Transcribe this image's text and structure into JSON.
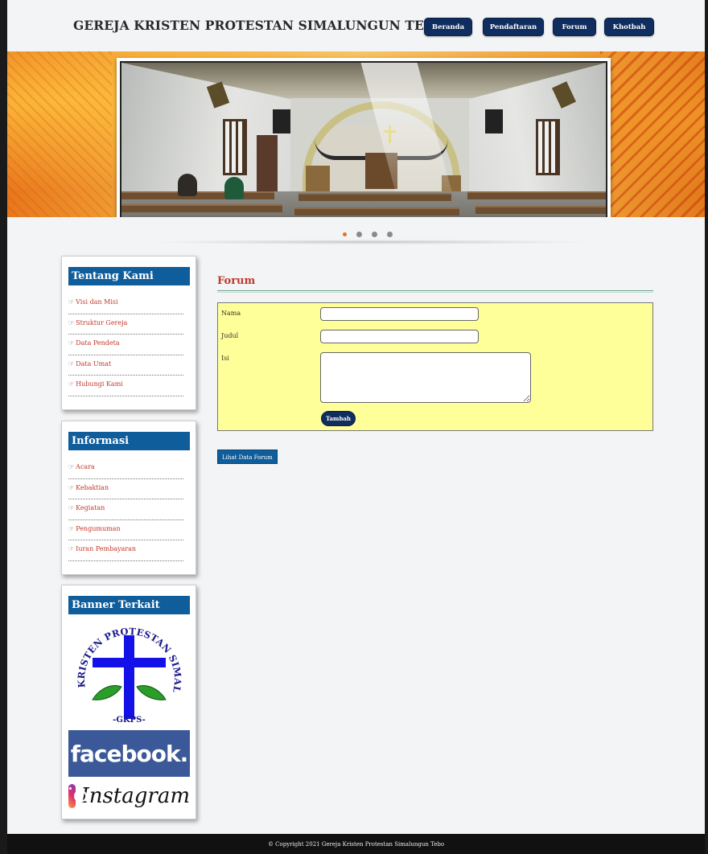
{
  "header": {
    "site_title": "GEREJA KRISTEN PROTESTAN SIMALUNGUN TEBO",
    "nav": [
      "Beranda",
      "Pendaftaran",
      "Forum",
      "Khotbah"
    ]
  },
  "slider": {
    "dots": 4,
    "active_index": 0
  },
  "sidebar": {
    "tentang_kami": {
      "title": "Tentang Kami",
      "items": [
        "Visi dan Misi",
        "Struktur Gereja",
        "Data Pendeta",
        "Data Umat",
        "Hubungi Kami"
      ]
    },
    "informasi": {
      "title": "Informasi",
      "items": [
        "Acara",
        "Kebaktian",
        "Kegiatan",
        "Pengumuman",
        "Iuran Pembayaran"
      ]
    },
    "banner_terkait": {
      "title": "Banner Terkait",
      "logo_text_top": "GEREJA KRISTEN PROTESTAN SIMALUNGUN",
      "logo_text_bottom": "-GKPS-",
      "facebook": "facebook.",
      "instagram": "Instagram"
    }
  },
  "forum": {
    "title": "Forum",
    "fields": [
      {
        "label": "Nama",
        "value": ""
      },
      {
        "label": "Judul",
        "value": ""
      },
      {
        "label": "Isi",
        "value": ""
      }
    ],
    "submit_label": "Tambah",
    "view_button": "Lihat Data Forum"
  },
  "footer": {
    "copyright": "© Copyright 2021 Gereja Kristen Protestan Simalungun Tebo"
  },
  "colors": {
    "nav_bg": "#0f2d5e",
    "side_title_bg": "#0f5d9b",
    "link": "#c0392b",
    "form_bg": "#ffff99",
    "footer_bg": "#111111",
    "dot_active": "#e8731c"
  }
}
